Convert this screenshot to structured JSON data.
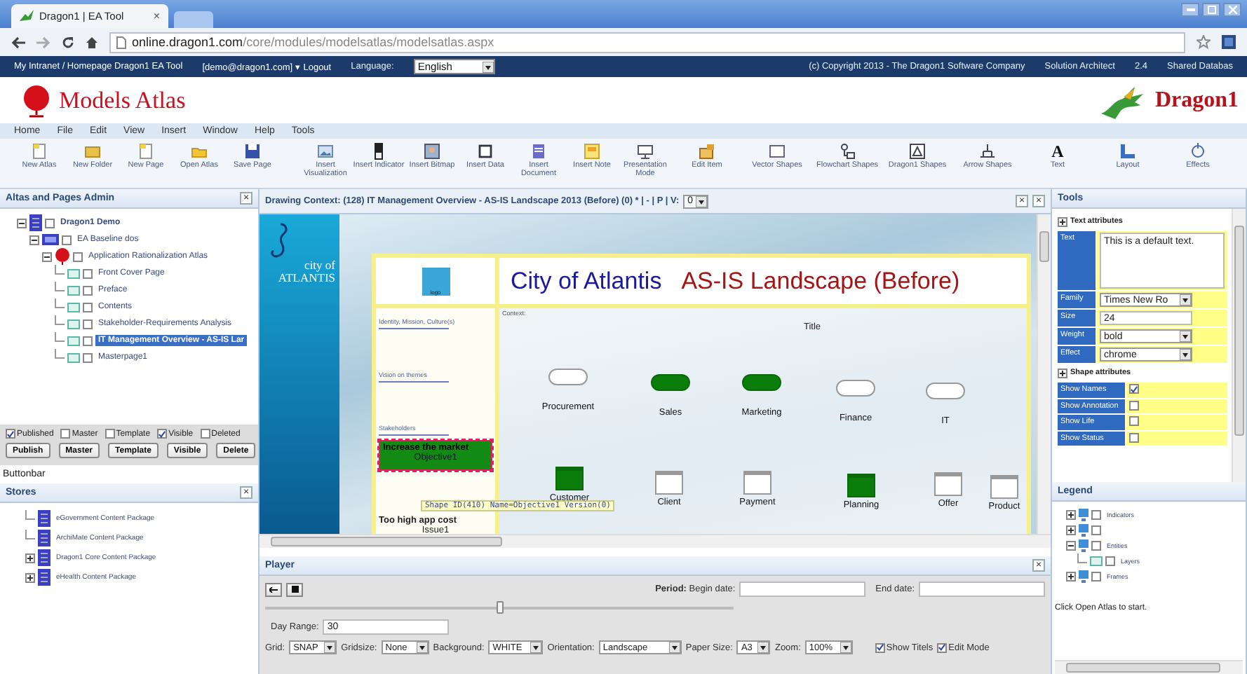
{
  "browser": {
    "tab_title": "Dragon1 | EA Tool",
    "tab_close": "×",
    "url_host": "online.dragon1.com",
    "url_path": "/core/modules/modelsatlas/modelsatlas.aspx"
  },
  "top_bar": {
    "home_link": "My Intranet / Homepage Dragon1 EA Tool",
    "account": "[demo@dragon1.com] ▾ Logout",
    "language_label": "Language:",
    "language": "English",
    "copyright": "(c) Copyright 2013 - The Dragon1 Software Company",
    "role": "Solution Architect",
    "version": "2.4",
    "database": "Shared Databas"
  },
  "header": {
    "app_title": "Models Atlas",
    "brand": "Dragon1"
  },
  "menu": [
    "Home",
    "File",
    "Edit",
    "View",
    "Insert",
    "Window",
    "Help",
    "Tools"
  ],
  "toolbar": [
    {
      "label": "New Atlas"
    },
    {
      "label": "New Folder"
    },
    {
      "label": "New Page"
    },
    {
      "label": "Open Atlas"
    },
    {
      "label": "Save Page"
    },
    {
      "label": "Insert Visualization"
    },
    {
      "label": "Insert Indicator"
    },
    {
      "label": "Insert Bitmap"
    },
    {
      "label": "Insert Data"
    },
    {
      "label": "Insert Document"
    },
    {
      "label": "Insert Note"
    },
    {
      "label": "Presentation Mode"
    },
    {
      "label": "Edit Item"
    },
    {
      "label": "Vector Shapes"
    },
    {
      "label": "Flowchart Shapes"
    },
    {
      "label": "Dragon1 Shapes"
    },
    {
      "label": "Arrow Shapes"
    },
    {
      "label": "Text",
      "glyph": "A"
    },
    {
      "label": "Layout"
    },
    {
      "label": "Effects"
    }
  ],
  "atlas_panel": {
    "title": "Altas and Pages Admin",
    "close": "×",
    "tree": [
      {
        "label": "Dragon1 Demo",
        "kind": "database",
        "checked": false,
        "selected": false,
        "expanded": true,
        "children": [
          {
            "label": "EA Baseline dos",
            "kind": "document",
            "checked": false,
            "selected": false,
            "expanded": true,
            "children": [
              {
                "label": "Application Rationalization Atlas",
                "kind": "atlas",
                "checked": false,
                "selected": false,
                "expanded": true,
                "children": [
                  {
                    "label": "Front Cover Page",
                    "kind": "page",
                    "checked": false,
                    "selected": false
                  },
                  {
                    "label": "Preface",
                    "kind": "page",
                    "checked": false,
                    "selected": false
                  },
                  {
                    "label": "Contents",
                    "kind": "page",
                    "checked": false,
                    "selected": false
                  },
                  {
                    "label": "Stakeholder-Requirements Analysis",
                    "kind": "page",
                    "checked": false,
                    "selected": false
                  },
                  {
                    "label": "IT Management Overview - AS-IS Lar",
                    "kind": "page",
                    "checked": false,
                    "selected": true
                  },
                  {
                    "label": "Masterpage1",
                    "kind": "page",
                    "checked": false,
                    "selected": false
                  }
                ]
              }
            ]
          }
        ]
      }
    ],
    "flags": [
      {
        "label": "Published",
        "checked": true
      },
      {
        "label": "Master",
        "checked": false
      },
      {
        "label": "Template",
        "checked": false
      },
      {
        "label": "Visible",
        "checked": true
      },
      {
        "label": "Deleted",
        "checked": false
      }
    ],
    "buttons": [
      "Publish",
      "Master",
      "Template",
      "Visible",
      "Delete"
    ],
    "button_bar": "Buttonbar"
  },
  "stores": {
    "title": "Stores",
    "close": "×",
    "items": [
      {
        "label": "eGovernment Content Package",
        "kind": "database"
      },
      {
        "label": "ArchiMate Content Package",
        "kind": "database"
      },
      {
        "label": "Dragon1 Core Content Package",
        "kind": "database",
        "expanded": false
      },
      {
        "label": "eHealth Content Package",
        "kind": "database",
        "expanded": false
      }
    ]
  },
  "drawing": {
    "context_title": "Drawing Context: (128) IT Management Overview - AS-IS Landscape 2013 (Before) (0) * | - | P | V:",
    "version": "0",
    "window_buttons": [
      "×",
      "×"
    ],
    "sidebar_lines": [
      "city of",
      "ATLANTIS"
    ],
    "logo_text": "logo",
    "title": "City of Atlantis",
    "subtitle": "AS-IS Landscape (Before)",
    "sections": [
      "Identity, Mission, Culture(s)",
      "Vision on themes",
      "Stakeholders"
    ],
    "objective": {
      "title": "Increase the market",
      "name": "Objective1",
      "selected": true
    },
    "issue": {
      "title": "Too high app cost",
      "name": "Issue1"
    },
    "context_label": "Context:",
    "diagram_title": "Title",
    "nodes": [
      {
        "label": "Procurement",
        "kind": "rounded",
        "filled": false
      },
      {
        "label": "Sales",
        "kind": "rounded",
        "filled": true
      },
      {
        "label": "Marketing",
        "kind": "rounded",
        "filled": true
      },
      {
        "label": "Finance",
        "kind": "rounded",
        "filled": false
      },
      {
        "label": "IT",
        "kind": "rounded",
        "filled": false
      },
      {
        "label": "Customer",
        "kind": "square",
        "filled": true
      },
      {
        "label": "Client",
        "kind": "square",
        "filled": false
      },
      {
        "label": "Payment",
        "kind": "square",
        "filled": false
      },
      {
        "label": "Planning",
        "kind": "square",
        "filled": true
      },
      {
        "label": "Offer",
        "kind": "square",
        "filled": false
      },
      {
        "label": "Product",
        "kind": "square",
        "filled": false
      }
    ],
    "tooltip": "Shape ID(410) Name=Objective1 Version(0)"
  },
  "player": {
    "title": "Player",
    "close": "×",
    "period_label": "Period:",
    "begin_label": "Begin date:",
    "end_label": "End date:",
    "slider": {
      "level": 0.5
    },
    "day_range_label": "Day Range:",
    "day_range": "30",
    "settings": [
      {
        "label": "Grid:",
        "value": "SNAP"
      },
      {
        "label": "Gridsize:",
        "value": "None"
      },
      {
        "label": "Background:",
        "value": "WHITE"
      },
      {
        "label": "Orientation:",
        "value": "Landscape"
      },
      {
        "label": "Paper Size:",
        "value": "A3"
      },
      {
        "label": "Zoom:",
        "value": "100%"
      }
    ],
    "options": [
      {
        "label": "Show Titels",
        "checked": true
      },
      {
        "label": "Edit Mode",
        "checked": true
      }
    ]
  },
  "tools": {
    "title": "Tools",
    "text_section": "Text attributes",
    "text_fields": [
      {
        "label": "Text",
        "kind": "textarea",
        "value": "This is a default text."
      },
      {
        "label": "Family",
        "kind": "select",
        "value": "Times New Ro"
      },
      {
        "label": "Size",
        "kind": "input",
        "value": "24"
      },
      {
        "label": "Weight",
        "kind": "select",
        "value": "bold"
      },
      {
        "label": "Effect",
        "kind": "select",
        "value": "chrome"
      }
    ],
    "shape_section": "Shape attributes",
    "shape_options": [
      {
        "label": "Show Names",
        "checked": true
      },
      {
        "label": "Show Annotation",
        "checked": false
      },
      {
        "label": "Show Life",
        "checked": false
      },
      {
        "label": "Show Status",
        "checked": false
      }
    ]
  },
  "legend": {
    "title": "Legend",
    "items": [
      {
        "label": "Indicators",
        "kind": "monitor",
        "checked": false,
        "expanded": false
      },
      {
        "kind": "monitor",
        "checked": false,
        "expanded": false
      },
      {
        "label": "Entities",
        "kind": "monitor",
        "checked": false,
        "expanded": true,
        "children": [
          {
            "label": "Layers",
            "kind": "page",
            "checked": false
          }
        ]
      },
      {
        "label": "Frames",
        "kind": "monitor",
        "checked": false,
        "expanded": false
      }
    ],
    "hint": "Click Open Atlas to start."
  }
}
